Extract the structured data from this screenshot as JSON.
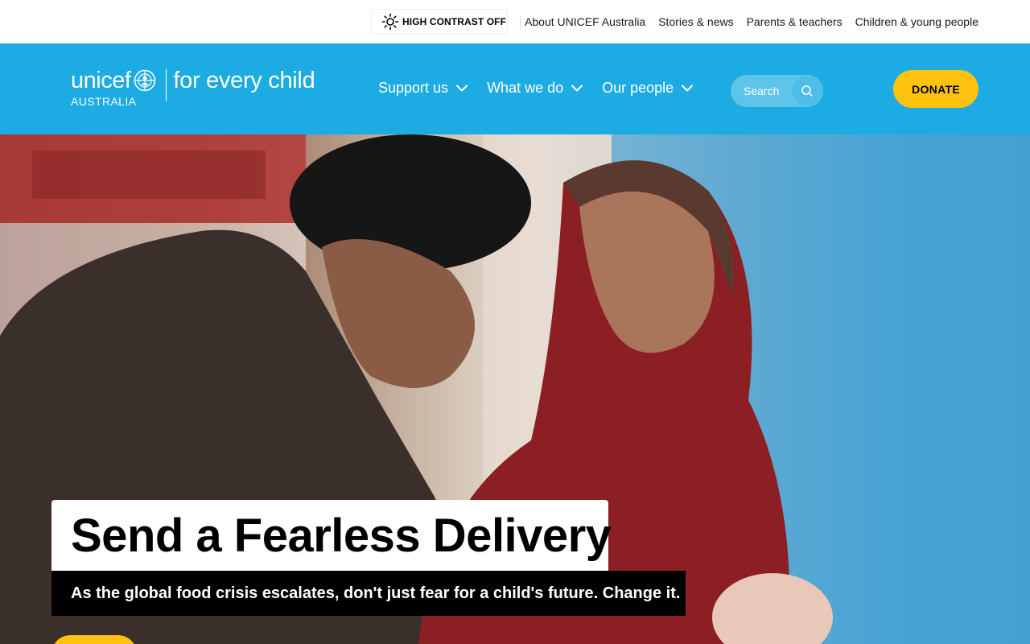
{
  "utility": {
    "contrast_label": "HIGH CONTRAST OFF",
    "links": [
      "About UNICEF Australia",
      "Stories & news",
      "Parents & teachers",
      "Children & young people"
    ]
  },
  "header": {
    "logo": {
      "wordmark": "unicef",
      "sub": "AUSTRALIA",
      "tagline": "for every child"
    },
    "nav": [
      "Support us",
      "What we do",
      "Our people"
    ],
    "search_placeholder": "Search",
    "donate_label": "DONATE"
  },
  "hero": {
    "title": "Send a Fearless Delivery",
    "subtitle": "As the global food crisis escalates, don't just fear for a child's future. Change it."
  },
  "colors": {
    "brand_blue": "#1CABE2",
    "accent_yellow": "#FFC20E",
    "text_dark": "#000000"
  },
  "icons": [
    "sun-icon",
    "unicef-emblem-icon",
    "chevron-down-icon",
    "search-icon"
  ]
}
